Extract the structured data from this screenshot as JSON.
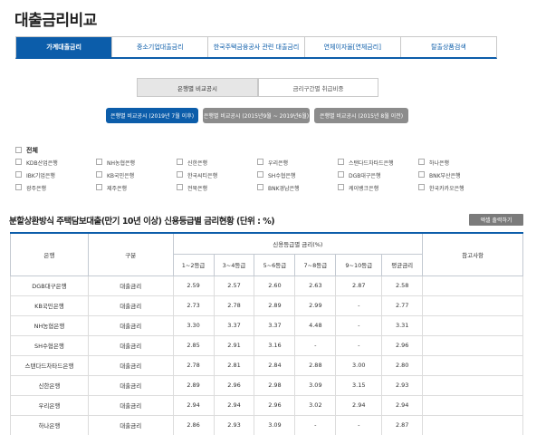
{
  "page": {
    "title": "대출금리비교"
  },
  "main_tabs": [
    {
      "label": "가계대출금리",
      "active": true
    },
    {
      "label": "중소기업대출금리",
      "active": false
    },
    {
      "label": "한국주택금융공사 관련 대출금리",
      "active": false
    },
    {
      "label": "연체이자율[연체금리]",
      "active": false
    },
    {
      "label": "탈출상품검색",
      "active": false
    }
  ],
  "sub_tabs": [
    {
      "label": "은행별 비교공시",
      "active": true
    },
    {
      "label": "금리구간별 취급비중",
      "active": false
    }
  ],
  "period_buttons": [
    {
      "label": "은행별 비교공시 (2019년 7월 이후)",
      "active": true
    },
    {
      "label": "은행별 비교공시 (2015년9월 ~ 2019년6월)",
      "active": false
    },
    {
      "label": "은행별 비교공시 (2015년 8월 이전)",
      "active": false
    }
  ],
  "bank_filter": {
    "all_label": "전체",
    "banks": [
      "KDB산업은행",
      "NH농협은행",
      "신한은행",
      "우리은행",
      "스탠다드차타드은행",
      "하나은행",
      "IBK기업은행",
      "KB국민은행",
      "한국씨티은행",
      "SH수협은행",
      "DGB대구은행",
      "BNK부산은행",
      "광주은행",
      "제주은행",
      "전북은행",
      "BNK경남은행",
      "케이뱅크은행",
      "한국카카오은행"
    ]
  },
  "section": {
    "title": "분할상환방식 주택담보대출(만기 10년 이상) 신용등급별 금리현황 (단위 : %)",
    "print_label": "엑셀 출력하기"
  },
  "table": {
    "headers": {
      "bank": "은행",
      "type": "구분",
      "group": "신용등급별 금리(%)",
      "grades": [
        "1~2등급",
        "3~4등급",
        "5~6등급",
        "7~8등급",
        "9~10등급",
        "평균금리"
      ],
      "note": "참고사항"
    },
    "rows": [
      {
        "bank": "DGB대구은행",
        "type": "대출금리",
        "values": [
          "2.59",
          "2.57",
          "2.60",
          "2.63",
          "2.87",
          "2.58"
        ]
      },
      {
        "bank": "KB국민은행",
        "type": "대출금리",
        "values": [
          "2.73",
          "2.78",
          "2.89",
          "2.99",
          "-",
          "2.77"
        ]
      },
      {
        "bank": "NH농협은행",
        "type": "대출금리",
        "values": [
          "3.30",
          "3.37",
          "3.37",
          "4.48",
          "-",
          "3.31"
        ]
      },
      {
        "bank": "SH수협은행",
        "type": "대출금리",
        "values": [
          "2.85",
          "2.91",
          "3.16",
          "-",
          "-",
          "2.96"
        ]
      },
      {
        "bank": "스탠다드차타드은행",
        "type": "대출금리",
        "values": [
          "2.78",
          "2.81",
          "2.84",
          "2.88",
          "3.00",
          "2.80"
        ]
      },
      {
        "bank": "신한은행",
        "type": "대출금리",
        "values": [
          "2.89",
          "2.96",
          "2.98",
          "3.09",
          "3.15",
          "2.93"
        ]
      },
      {
        "bank": "우리은행",
        "type": "대출금리",
        "values": [
          "2.94",
          "2.94",
          "2.96",
          "3.02",
          "2.94",
          "2.94"
        ]
      },
      {
        "bank": "하나은행",
        "type": "대출금리",
        "values": [
          "2.86",
          "2.93",
          "3.09",
          "-",
          "-",
          "2.87"
        ]
      }
    ]
  }
}
